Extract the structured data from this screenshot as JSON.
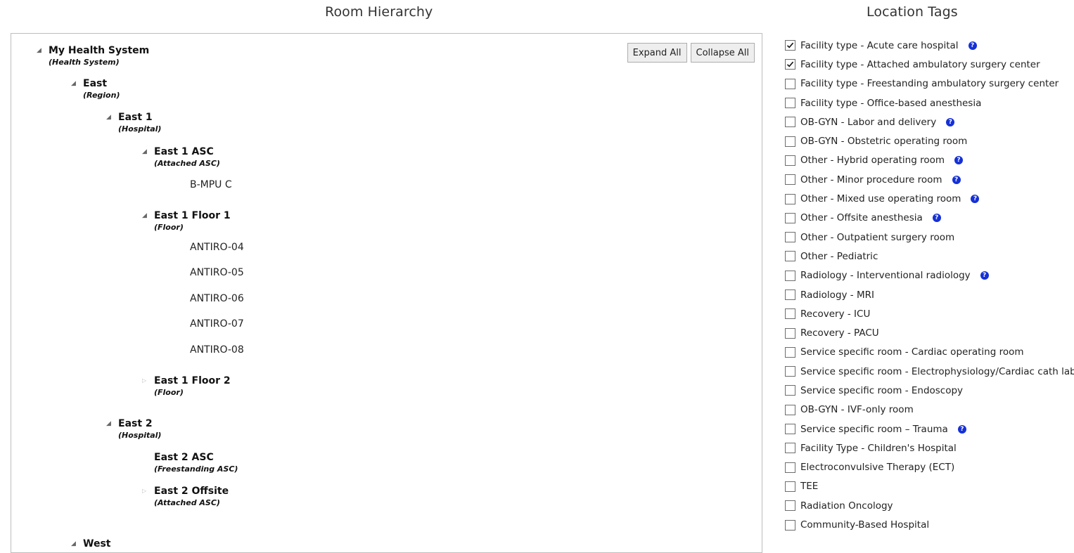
{
  "room_hierarchy": {
    "title": "Room Hierarchy",
    "expand_all": "Expand All",
    "collapse_all": "Collapse All",
    "nodes": [
      {
        "name": "My Health System",
        "type": "(Health System)",
        "expanded": true
      },
      {
        "name": "East",
        "type": "(Region)",
        "expanded": true
      },
      {
        "name": "East 1",
        "type": "(Hospital)",
        "expanded": true
      },
      {
        "name": "East 1 ASC",
        "type": "(Attached ASC)",
        "expanded": true
      },
      {
        "name": "East 1 Floor 1",
        "type": "(Floor)",
        "expanded": true
      },
      {
        "name": "East 1 Floor 2",
        "type": "(Floor)",
        "expanded": false
      },
      {
        "name": "East 2",
        "type": "(Hospital)",
        "expanded": true
      },
      {
        "name": "East 2 ASC",
        "type": "(Freestanding ASC)"
      },
      {
        "name": "East 2 Offsite",
        "type": "(Attached ASC)",
        "expanded": false
      },
      {
        "name": "West",
        "expanded": true
      }
    ],
    "rooms": [
      "B-MPU C",
      "ANTIRO-04",
      "ANTIRO-05",
      "ANTIRO-06",
      "ANTIRO-07",
      "ANTIRO-08"
    ]
  },
  "location_tags": {
    "title": "Location Tags",
    "items": [
      {
        "label": "Facility type - Acute care hospital",
        "checked": true,
        "help": true
      },
      {
        "label": "Facility type - Attached ambulatory surgery center",
        "checked": true,
        "help": false
      },
      {
        "label": "Facility type - Freestanding ambulatory surgery center",
        "checked": false,
        "help": false
      },
      {
        "label": "Facility type - Office-based anesthesia",
        "checked": false,
        "help": false
      },
      {
        "label": "OB-GYN - Labor and delivery",
        "checked": false,
        "help": true
      },
      {
        "label": "OB-GYN - Obstetric operating room",
        "checked": false,
        "help": false
      },
      {
        "label": "Other - Hybrid operating room",
        "checked": false,
        "help": true
      },
      {
        "label": "Other - Minor procedure room",
        "checked": false,
        "help": true
      },
      {
        "label": "Other - Mixed use operating room",
        "checked": false,
        "help": true
      },
      {
        "label": "Other - Offsite anesthesia",
        "checked": false,
        "help": true
      },
      {
        "label": "Other - Outpatient surgery room",
        "checked": false,
        "help": false
      },
      {
        "label": "Other - Pediatric",
        "checked": false,
        "help": false
      },
      {
        "label": "Radiology - Interventional radiology",
        "checked": false,
        "help": true
      },
      {
        "label": "Radiology - MRI",
        "checked": false,
        "help": false
      },
      {
        "label": "Recovery - ICU",
        "checked": false,
        "help": false
      },
      {
        "label": "Recovery - PACU",
        "checked": false,
        "help": false
      },
      {
        "label": "Service specific room - Cardiac operating room",
        "checked": false,
        "help": false
      },
      {
        "label": "Service specific room - Electrophysiology/Cardiac cath lab",
        "checked": false,
        "help": false
      },
      {
        "label": "Service specific room - Endoscopy",
        "checked": false,
        "help": false
      },
      {
        "label": "OB-GYN - IVF-only room",
        "checked": false,
        "help": false
      },
      {
        "label": "Service specific room – Trauma",
        "checked": false,
        "help": true
      },
      {
        "label": "Facility Type - Children's Hospital",
        "checked": false,
        "help": false
      },
      {
        "label": "Electroconvulsive Therapy (ECT)",
        "checked": false,
        "help": false
      },
      {
        "label": "TEE",
        "checked": false,
        "help": false
      },
      {
        "label": "Radiation Oncology",
        "checked": false,
        "help": false
      },
      {
        "label": "Community-Based Hospital",
        "checked": false,
        "help": false
      }
    ],
    "help_glyph": "?"
  },
  "colors": {
    "help_icon": "#1530d6",
    "panel_border": "#bdbdbd",
    "button_bg": "#eeeeee"
  }
}
